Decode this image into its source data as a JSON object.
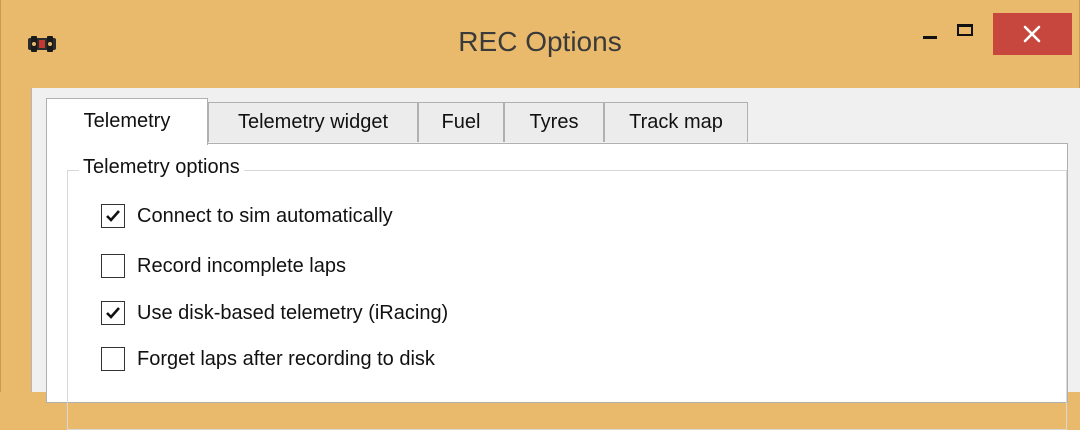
{
  "window": {
    "title": "REC Options",
    "icon": "app-logo-icon",
    "controls": [
      "minimize-icon",
      "maximize-icon",
      "close-icon"
    ],
    "accent_color": "#e9b96c",
    "close_color": "#c7463d"
  },
  "tabs": [
    {
      "label": "Telemetry",
      "active": true
    },
    {
      "label": "Telemetry widget",
      "active": false
    },
    {
      "label": "Fuel",
      "active": false
    },
    {
      "label": "Tyres",
      "active": false
    },
    {
      "label": "Track map",
      "active": false
    }
  ],
  "group": {
    "title": "Telemetry options",
    "options": [
      {
        "label": "Connect to sim automatically",
        "checked": true
      },
      {
        "label": "Record incomplete laps",
        "checked": false
      },
      {
        "label": "Use disk-based telemetry (iRacing)",
        "checked": true
      },
      {
        "label": "Forget laps after recording to disk",
        "checked": false
      }
    ]
  }
}
